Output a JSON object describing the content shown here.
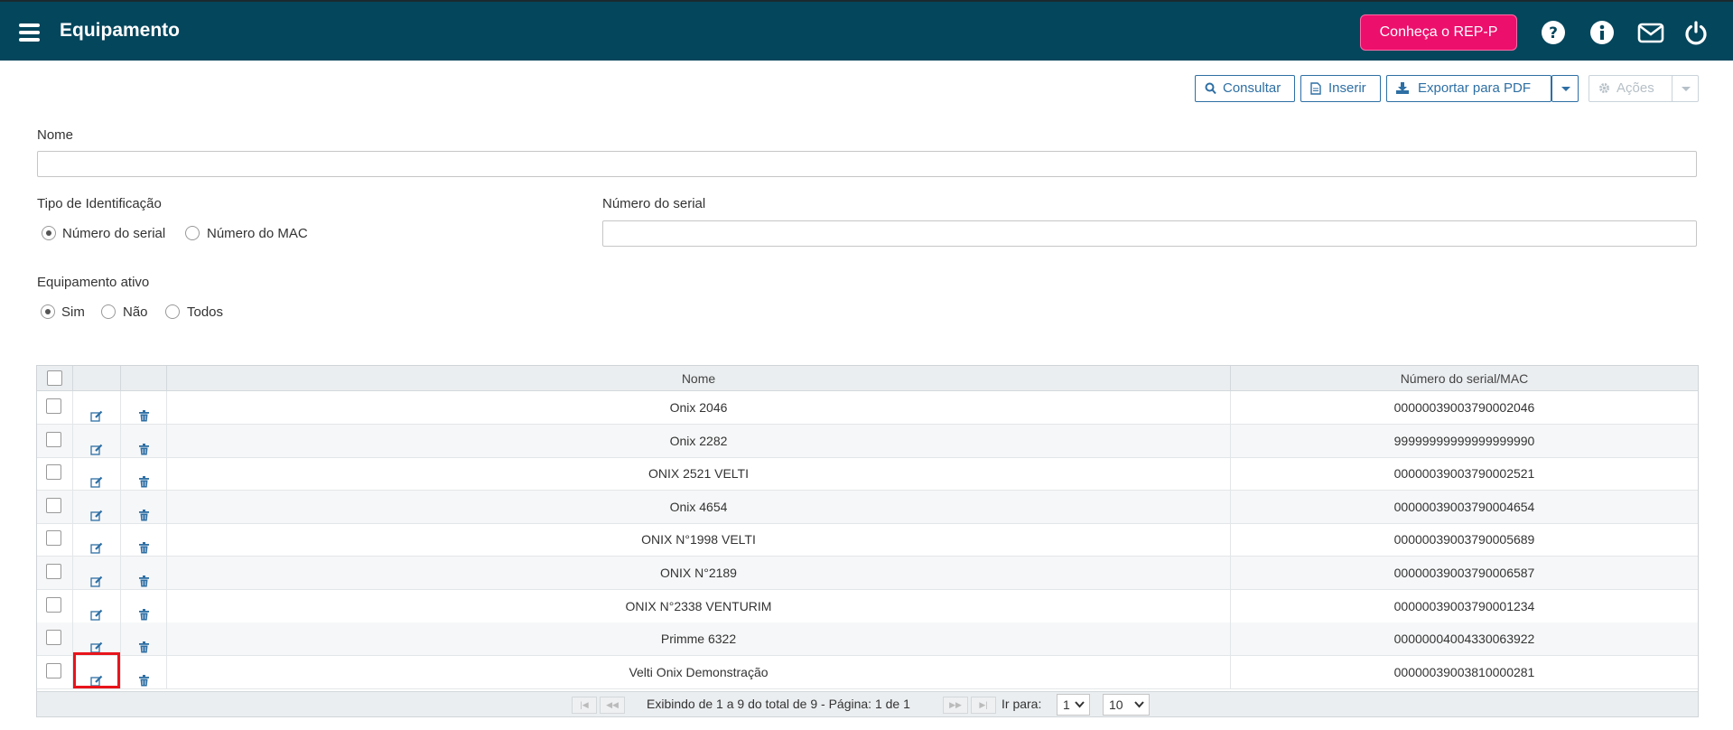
{
  "header": {
    "title": "Equipamento",
    "rep_button": "Conheça o REP-P",
    "icons": [
      "menu-icon",
      "help-icon",
      "info-icon",
      "mail-icon",
      "power-icon"
    ],
    "bg_color": "#04465c",
    "accent_color": "#ec0f6c"
  },
  "toolbar": {
    "consultar": "Consultar",
    "inserir": "Inserir",
    "exportar": "Exportar para PDF",
    "acoes": "Ações"
  },
  "form": {
    "nome_label": "Nome",
    "nome_value": "",
    "tipo_label": "Tipo de Identificação",
    "tipo_options": [
      "Número do serial",
      "Número do MAC"
    ],
    "tipo_selected": "Número do serial",
    "serial_label": "Número do serial",
    "serial_value": "",
    "ativo_label": "Equipamento ativo",
    "ativo_options": [
      "Sim",
      "Não",
      "Todos"
    ],
    "ativo_selected": "Sim"
  },
  "grid": {
    "columns": [
      "Nome",
      "Número do serial/MAC"
    ],
    "rows": [
      {
        "nome": "Onix 2046",
        "serial": "0000003900379000204 6"
      },
      {
        "nome": "Onix 2282",
        "serial": "99999999999999999990"
      },
      {
        "nome": "ONIX 2521 VELTI",
        "serial": "00000039003790002521"
      },
      {
        "nome": "Onix 4654",
        "serial": "00000039003790004654"
      },
      {
        "nome": "ONIX N°1998 VELTI",
        "serial": "00000039003790005689"
      },
      {
        "nome": "ONIX N°2189",
        "serial": "00000039003790006587"
      },
      {
        "nome": "ONIX N°2338 VENTURIM",
        "serial": "00000039003790001234"
      },
      {
        "nome": "Primme 6322",
        "serial": "00000004004330063922"
      },
      {
        "nome": "Velti Onix Demonstração",
        "serial": "00000039003810000281"
      }
    ],
    "pager": {
      "status": "Exibindo de 1 a 9 do total de 9 - Página: 1 de 1",
      "goto_label": "Ir para:",
      "page": "1",
      "page_size": "10"
    }
  }
}
